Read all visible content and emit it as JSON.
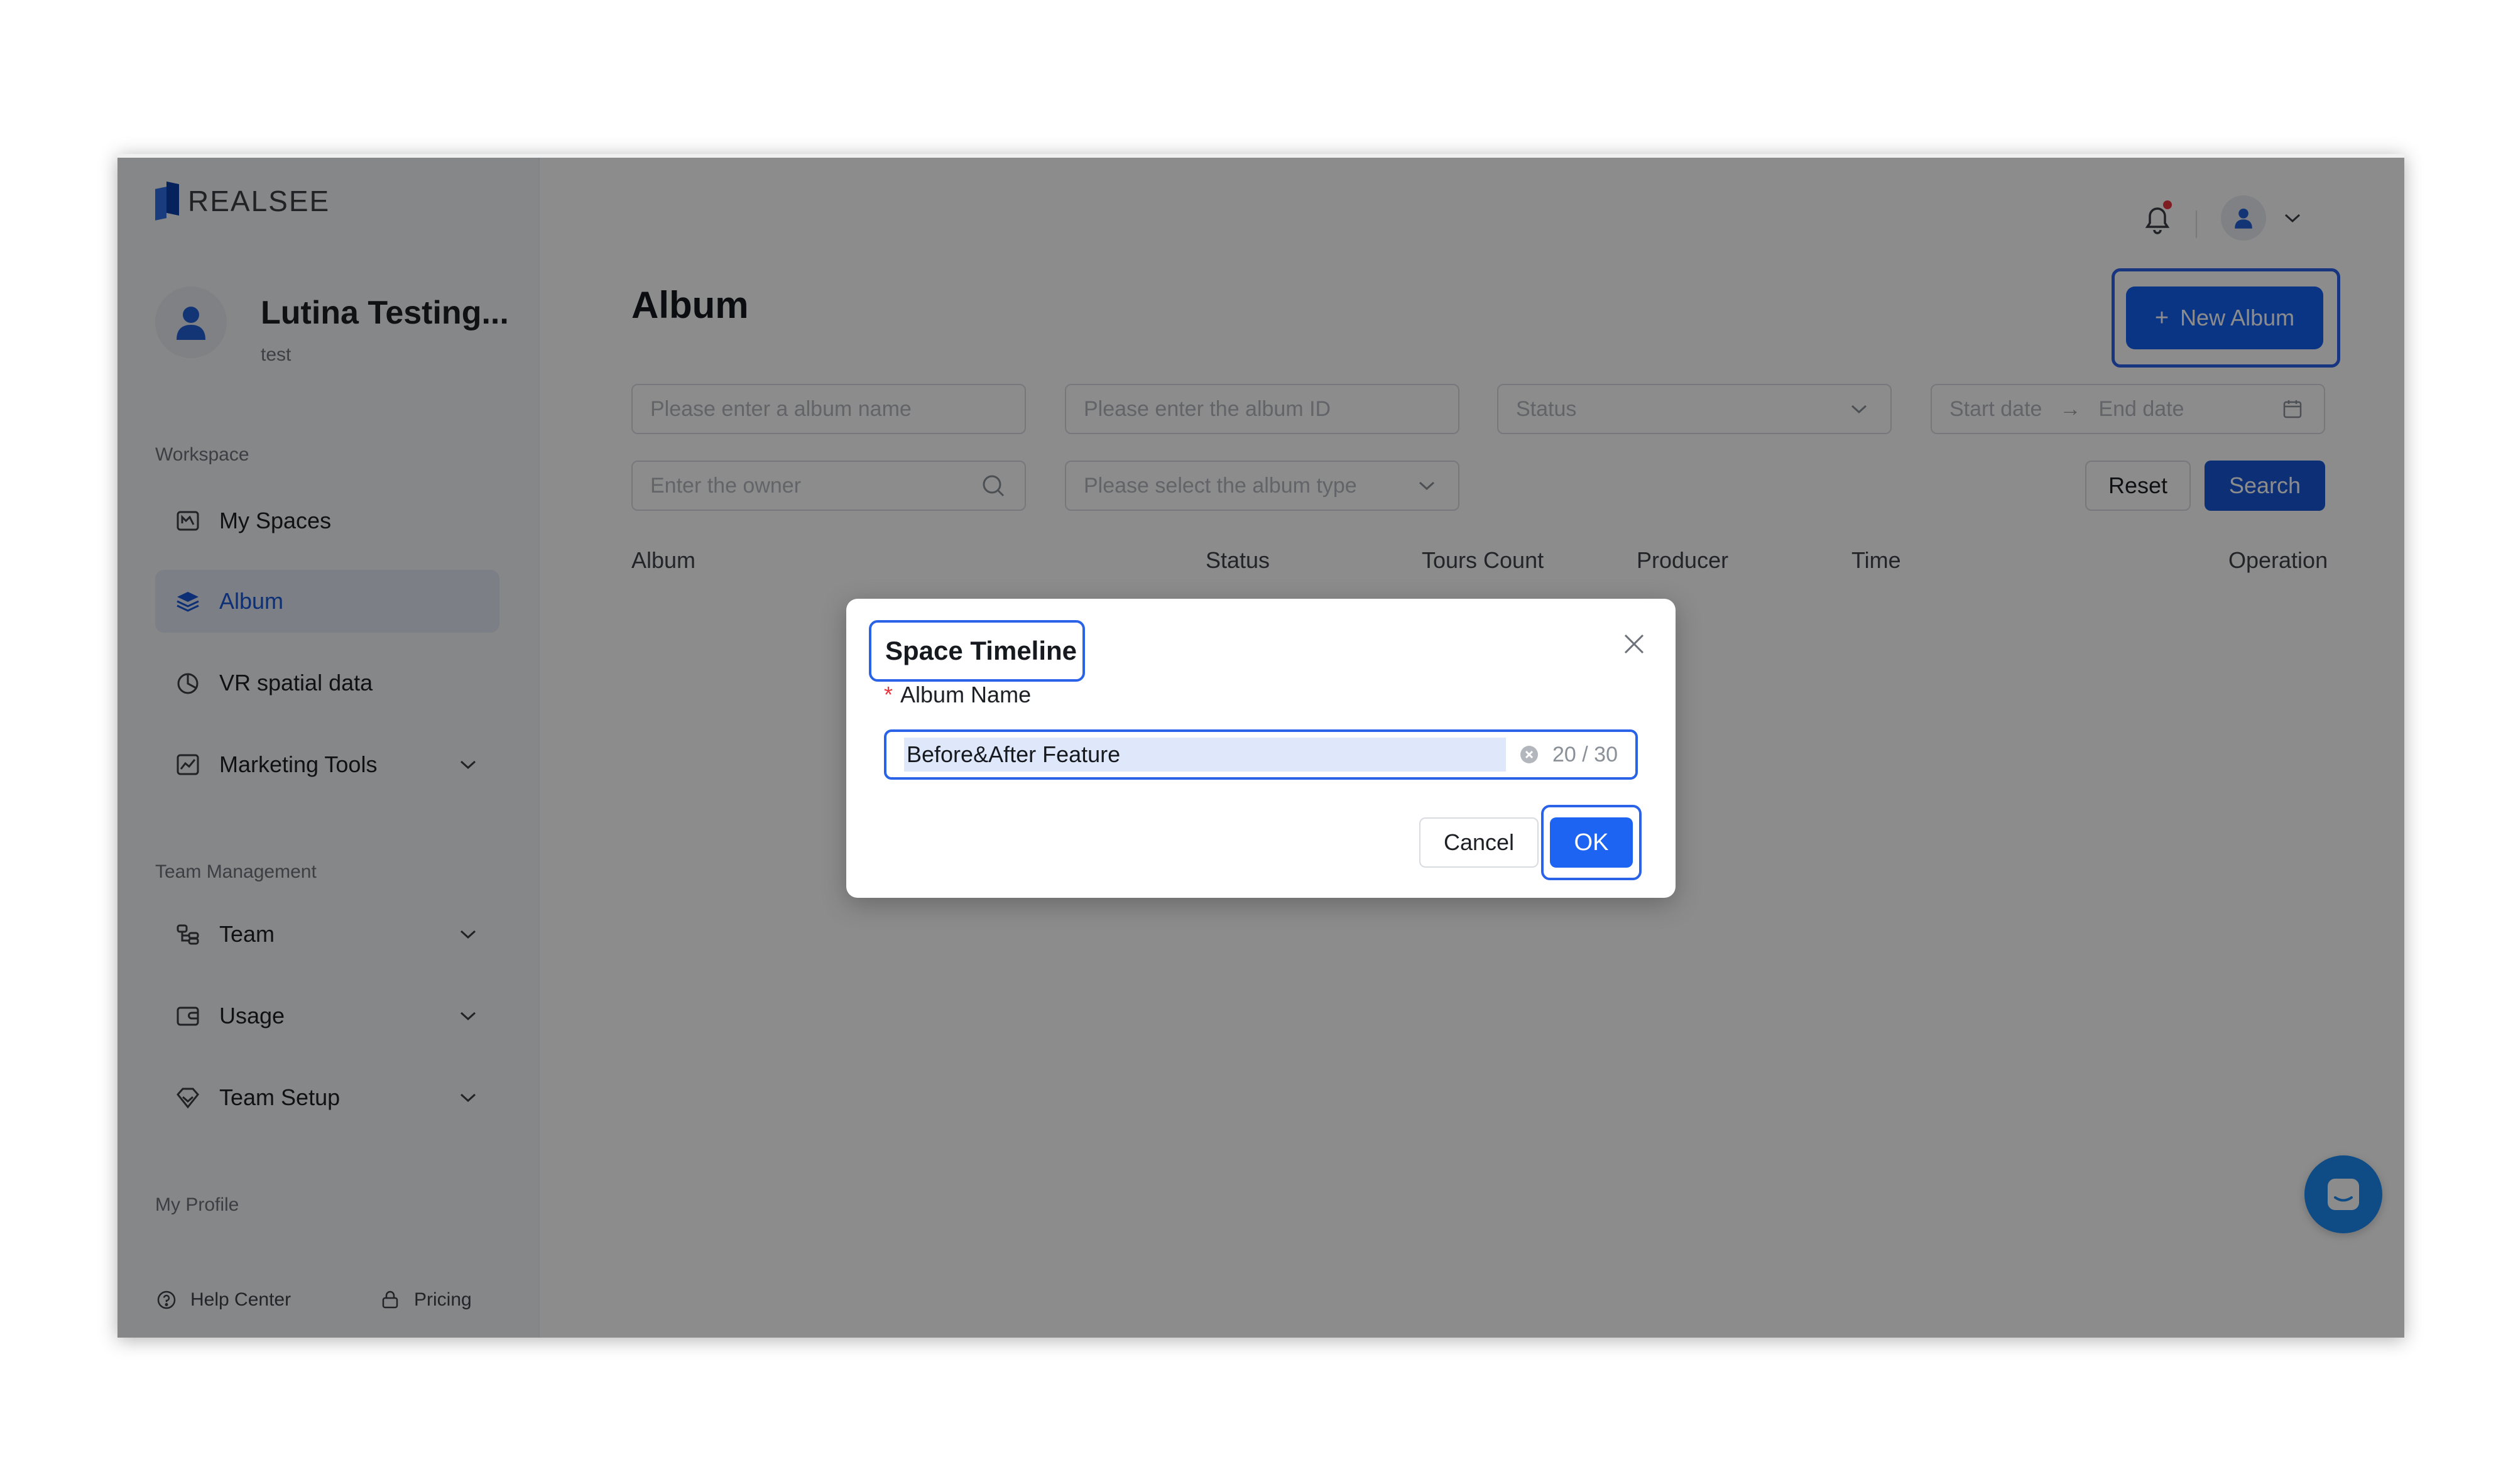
{
  "brand": {
    "name": "REALSEE"
  },
  "profile": {
    "name": "Lutina Testing...",
    "subtitle": "test"
  },
  "sidebar": {
    "workspace_label": "Workspace",
    "workspace_items": [
      {
        "label": "My Spaces",
        "icon": "spaces-icon"
      },
      {
        "label": "Album",
        "icon": "album-icon",
        "active": true
      },
      {
        "label": "VR spatial data",
        "icon": "chart-pie-icon"
      },
      {
        "label": "Marketing Tools",
        "icon": "marketing-icon",
        "expandable": true
      }
    ],
    "team_label": "Team Management",
    "team_items": [
      {
        "label": "Team",
        "icon": "team-icon",
        "expandable": true
      },
      {
        "label": "Usage",
        "icon": "wallet-icon",
        "expandable": true
      },
      {
        "label": "Team Setup",
        "icon": "diamond-icon",
        "expandable": true
      }
    ],
    "profile_label": "My Profile",
    "footer": {
      "help": "Help Center",
      "pricing": "Pricing"
    }
  },
  "main": {
    "title": "Album",
    "new_album_label": "New Album",
    "filters": {
      "album_name_placeholder": "Please enter a album name",
      "album_id_placeholder": "Please enter the album ID",
      "status_placeholder": "Status",
      "start_date_placeholder": "Start date",
      "end_date_placeholder": "End date",
      "owner_placeholder": "Enter the owner",
      "album_type_placeholder": "Please select the album type"
    },
    "reset_label": "Reset",
    "search_label": "Search",
    "table_headers": [
      "Album",
      "Status",
      "Tours Count",
      "Producer",
      "Time",
      "Operation"
    ]
  },
  "modal": {
    "title": "Space Timeline",
    "field_label": "Album Name",
    "field_value": "Before&After Feature",
    "counter": "20 / 30",
    "cancel_label": "Cancel",
    "ok_label": "OK"
  },
  "colors": {
    "primary": "#1656d6",
    "focus_outline": "#2a63e8",
    "notification_dot": "#e5373f",
    "chat": "#1d8bf5"
  }
}
